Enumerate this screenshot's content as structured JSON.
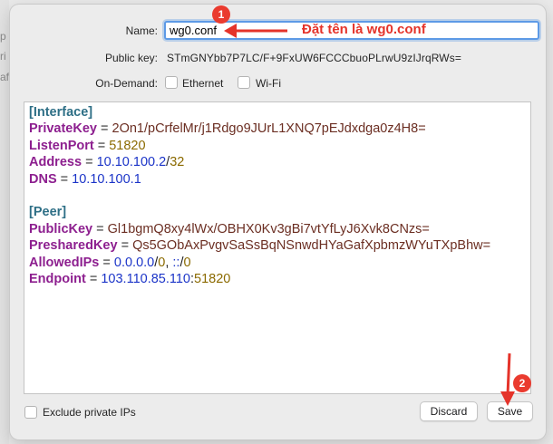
{
  "backdrop": {
    "fragments": [
      "p",
      "ri",
      "af"
    ]
  },
  "form": {
    "name_label": "Name:",
    "name_value": "wg0.conf",
    "public_key_label": "Public key:",
    "public_key_value": "STmGNYbb7P7LC/F+9FxUW6FCCCbuoPLrwU9zIJrqRWs=",
    "on_demand_label": "On-Demand:",
    "ethernet_label": "Ethernet",
    "wifi_label": "Wi-Fi",
    "ethernet_checked": false,
    "wifi_checked": false
  },
  "config": {
    "interface_header": "[Interface]",
    "private_key_key": "PrivateKey",
    "private_key_value": "2On1/pCrfelMr/j1Rdgo9JUrL1XNQ7pEJdxdga0z4H8=",
    "listen_port_key": "ListenPort",
    "listen_port_value": "51820",
    "address_key": "Address",
    "address_ip": "10.10.100.2",
    "address_mask": "32",
    "dns_key": "DNS",
    "dns_value": "10.10.100.1",
    "peer_header": "[Peer]",
    "public_key_key": "PublicKey",
    "public_key_value": "Gl1bgmQ8xy4lWx/OBHX0Kv3gBi7vtYfLyJ6Xvk8CNzs=",
    "preshared_key_key": "PresharedKey",
    "preshared_key_value": "Qs5GObAxPvgvSaSsBqNSnwdHYaGafXpbmzWYuTXpBhw=",
    "allowed_ips_key": "AllowedIPs",
    "allowed_v4_ip": "0.0.0.0",
    "allowed_v4_mask": "0",
    "allowed_v6_ip": "::",
    "allowed_v6_mask": "0",
    "endpoint_key": "Endpoint",
    "endpoint_ip": "103.110.85.110",
    "endpoint_port": "51820",
    "equals": "=",
    "slash": "/",
    "comma": ",",
    "colon": ":"
  },
  "footer": {
    "exclude_private_label": "Exclude private IPs",
    "exclude_private_checked": false,
    "discard_label": "Discard",
    "save_label": "Save"
  },
  "annotations": {
    "badge_1": "1",
    "badge_2": "2",
    "note_1": "Đặt tên là wg0.conf",
    "color": "#e5332a"
  }
}
